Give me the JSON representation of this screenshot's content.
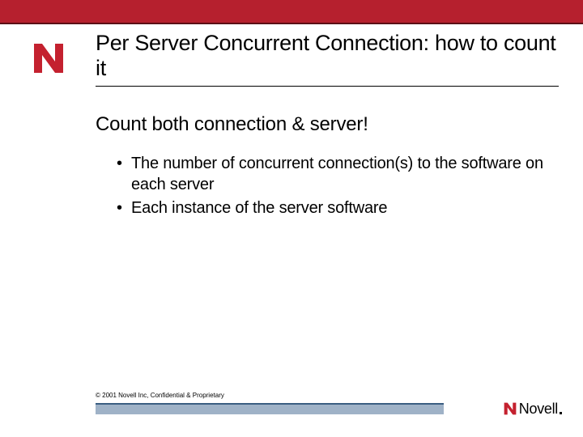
{
  "slide": {
    "title": "Per Server Concurrent Connection: how to count it",
    "subheading": "Count both connection & server!",
    "bullets": [
      "The number of  concurrent connection(s) to the software on each server",
      "Each instance of the server software"
    ],
    "footer": "© 2001 Novell Inc, Confidential & Proprietary",
    "brand": "Novell"
  },
  "colors": {
    "band": "#b6202e",
    "bandShadow": "#5b1016",
    "footerBar": "#9fb2c7",
    "footerBarTop": "#3b5e82",
    "logoRed": "#c4212f"
  }
}
